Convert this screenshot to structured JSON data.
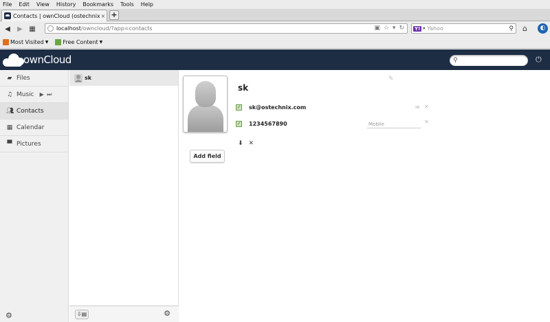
{
  "browser": {
    "menu": [
      "File",
      "Edit",
      "View",
      "History",
      "Bookmarks",
      "Tools",
      "Help"
    ],
    "tab": {
      "title": "Contacts | ownCloud (ostechnix)",
      "close_icon": "×",
      "new_tab_icon": "+"
    },
    "url": {
      "host": "localhost",
      "path": "/owncloud/?app=contacts"
    },
    "search": {
      "engine": "Y!",
      "placeholder": "Yahoo"
    },
    "bookmarks": [
      "Most Visited",
      "Free Content"
    ]
  },
  "header": {
    "logo_text": "ownCloud",
    "search_icon": "search-icon",
    "logout_icon": "power-icon",
    "bg_color": "#1d2d44"
  },
  "apps": [
    {
      "label": "Files",
      "icon": "folder-icon"
    },
    {
      "label": "Music",
      "icon": "music-icon",
      "controls": "▶ ⏭"
    },
    {
      "label": "Contacts",
      "icon": "contacts-icon",
      "active": true
    },
    {
      "label": "Calendar",
      "icon": "calendar-icon"
    },
    {
      "label": "Pictures",
      "icon": "pictures-icon"
    }
  ],
  "contacts": [
    {
      "name": "sk"
    }
  ],
  "detail": {
    "name": "sk",
    "email": "sk@ostechnix.com",
    "phone": "1234567890",
    "phone_type_placeholder": "Mobile",
    "add_field_label": "Add field"
  }
}
